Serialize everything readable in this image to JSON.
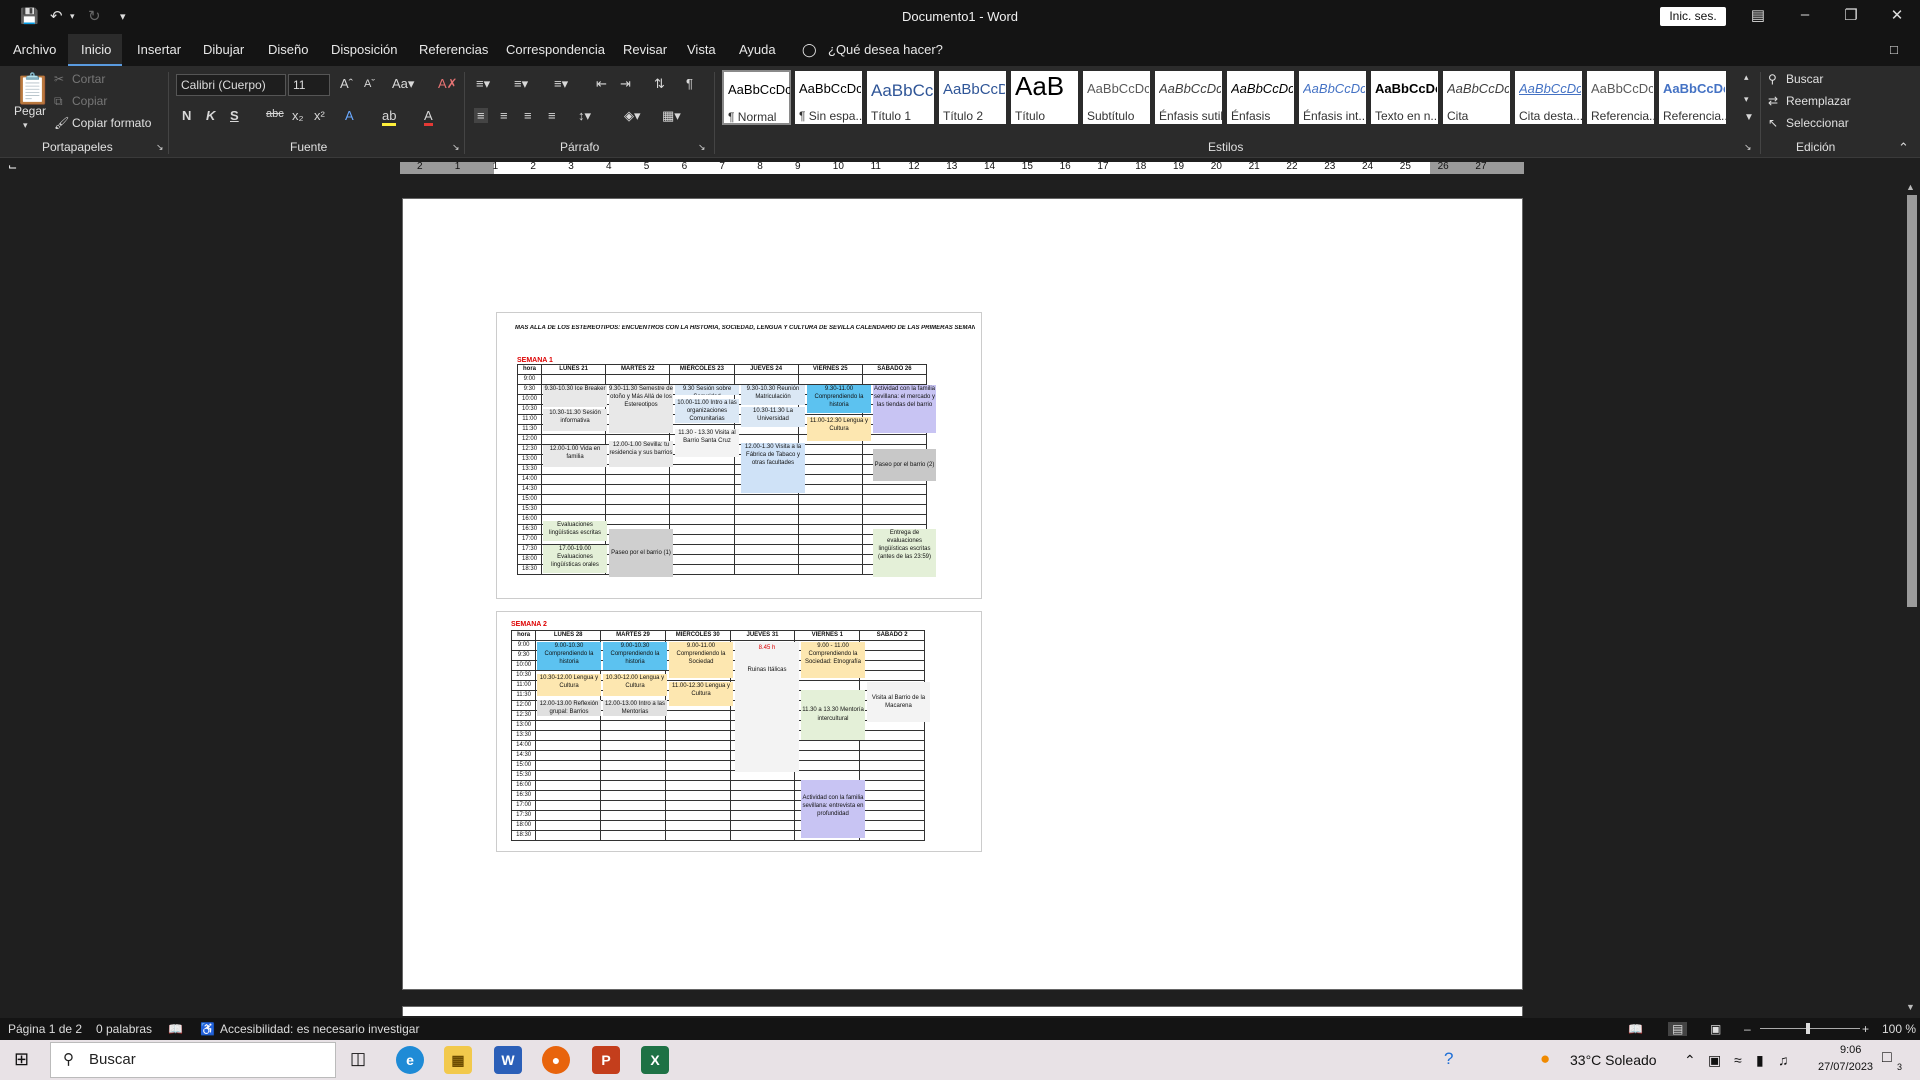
{
  "window": {
    "title": "Documento1  -  Word",
    "signin": "Inic. ses."
  },
  "menu": {
    "items": [
      "Archivo",
      "Inicio",
      "Insertar",
      "Dibujar",
      "Diseño",
      "Disposición",
      "Referencias",
      "Correspondencia",
      "Revisar",
      "Vista",
      "Ayuda"
    ],
    "tell_me": "¿Qué desea hacer?"
  },
  "ribbon": {
    "clipboard": {
      "paste": "Pegar",
      "cut": "Cortar",
      "copy": "Copiar",
      "format_painter": "Copiar formato",
      "label": "Portapapeles"
    },
    "font": {
      "family": "Calibri (Cuerpo)",
      "size": "11",
      "bold": "N",
      "italic": "K",
      "underline": "S",
      "label": "Fuente"
    },
    "paragraph": {
      "label": "Párrafo"
    },
    "styles": {
      "label": "Estilos",
      "items": [
        {
          "preview": "AaBbCcDc",
          "name": "¶ Normal"
        },
        {
          "preview": "AaBbCcDc",
          "name": "¶ Sin espa..."
        },
        {
          "preview": "AaBbCc",
          "name": "Título 1"
        },
        {
          "preview": "AaBbCcD",
          "name": "Título 2"
        },
        {
          "preview": "AaB",
          "name": "Título"
        },
        {
          "preview": "AaBbCcDc",
          "name": "Subtítulo"
        },
        {
          "preview": "AaBbCcDc",
          "name": "Énfasis sutil"
        },
        {
          "preview": "AaBbCcDc",
          "name": "Énfasis"
        },
        {
          "preview": "AaBbCcDc",
          "name": "Énfasis int..."
        },
        {
          "preview": "AaBbCcDc",
          "name": "Texto en n..."
        },
        {
          "preview": "AaBbCcDc",
          "name": "Cita"
        },
        {
          "preview": "AaBbCcDc",
          "name": "Cita desta..."
        },
        {
          "preview": "AaBbCcDc",
          "name": "Referencia..."
        },
        {
          "preview": "AaBbCcDc",
          "name": "Referencia..."
        }
      ]
    },
    "editing": {
      "find": "Buscar",
      "replace": "Reemplazar",
      "select": "Seleccionar",
      "label": "Edición"
    }
  },
  "ruler": {
    "numbers": [
      "2",
      "1",
      "1",
      "2",
      "3",
      "4",
      "5",
      "6",
      "7",
      "8",
      "9",
      "10",
      "11",
      "12",
      "13",
      "14",
      "15",
      "16",
      "17",
      "18",
      "19",
      "20",
      "21",
      "22",
      "23",
      "24",
      "25",
      "26",
      "27"
    ]
  },
  "document": {
    "title": "MÁS ALLÁ DE LOS ESTEREOTIPOS: ENCUENTROS CON LA HISTORIA, SOCIEDAD, LENGUA Y CULTURA DE SEVILLA CALENDARIO DE LAS PRIMERAS SEMANAS",
    "week1": {
      "label": "SEMANA 1",
      "headers": [
        "hora",
        "LUNES 21",
        "MARTES 22",
        "MIÉRCOLES 23",
        "JUEVES 24",
        "VIERNES 25",
        "SÁBADO 26"
      ],
      "hours": [
        "9:00",
        "9:30",
        "10:00",
        "10:30",
        "11:00",
        "11:30",
        "12:00",
        "12:30",
        "13:00",
        "13:30",
        "14:00",
        "14:30",
        "15:00",
        "15:30",
        "16:00",
        "16:30",
        "17:00",
        "17:30",
        "18:00",
        "18:30"
      ],
      "events": {
        "mon1": "9.30-10.30 Ice Breaker",
        "mon2": "10.30-11.30 Sesión informativa",
        "mon3": "12.00-1.00 Vida en familia",
        "mon4": "Evaluaciones lingüísticas escritas",
        "mon5": "17.00-19.00 Evaluaciones lingüísticas orales",
        "tue1": "9.30-11.30 Semestre de otoño y Más Allá de los Estereotipos",
        "tue2": "12.00-1.00 Sevilla: tu residencia y sus barrios",
        "tue3": "Paseo por el barrio (1)",
        "wed1": "9.30 Sesión sobre Seguridad",
        "wed2": "10.00-11.00 Intro a las organizaciones Comunitarias",
        "wed3": "11.30 - 13.30 Visita al Barrio Santa Cruz",
        "thu1": "9.30-10.30 Reunión Matriculación",
        "thu2": "10.30-11.30 La Universidad",
        "thu3": "12.00-1.30 Visita a la Fábrica de Tabaco y otras facultades",
        "fri1": "9.30-11.00 Comprendiendo la historia",
        "fri2": "11.00-12.30 Lengua y Cultura",
        "sat1": "Actividad con la familia sevillana: el mercado y las tiendas del barrio",
        "sat2": "Paseo por el barrio (2)",
        "sat3": "Entrega de evaluaciones lingüísticas escritas (antes de las 23:59)"
      }
    },
    "week2": {
      "label": "SEMANA 2",
      "headers": [
        "hora",
        "LUNES 28",
        "MARTES 29",
        "MIÉRCOLES 30",
        "JUEVES 31",
        "VIERNES 1",
        "SÁBADO 2"
      ],
      "hours": [
        "9:00",
        "9:30",
        "10:00",
        "10:30",
        "11:00",
        "11:30",
        "12:00",
        "12:30",
        "13:00",
        "13:30",
        "14:00",
        "14:30",
        "15:00",
        "15:30",
        "16:00",
        "16:30",
        "17:00",
        "17:30",
        "18:00",
        "18:30"
      ],
      "events": {
        "mon1": "9.00-10.30 Comprendiendo la historia",
        "mon2": "10.30-12.00 Lengua y Cultura",
        "mon3": "12.00-13.00 Reflexión grupal: Barrios",
        "tue1": "9.00-10.30 Comprendiendo la historia",
        "tue2": "10.30-12.00 Lengua y Cultura",
        "tue3": "12.00-13.00 Intro a las Mentorías",
        "wed1": "9.00-11.00 Comprendiendo la Sociedad",
        "wed2": "11.00-12.30 Lengua y Cultura",
        "thu0": "8.45 h",
        "thu1": "Ruinas Itálicas",
        "fri1": "9.00 - 11.00 Comprendiendo la Sociedad: Etnografía",
        "fri2": "11.30 a 13.30 Mentoría intercultural",
        "fri3": "Actividad con la familia sevillana: entrevista en profundidad",
        "sat1": "Visita al Barrio de la Macarena"
      }
    }
  },
  "status": {
    "page": "Página 1 de 2",
    "words": "0 palabras",
    "accessibility": "Accesibilidad: es necesario investigar",
    "zoom": "100 %"
  },
  "taskbar": {
    "search": "Buscar",
    "weather": "33°C  Soleado",
    "time": "9:06",
    "date": "27/07/2023",
    "notif": "3"
  }
}
